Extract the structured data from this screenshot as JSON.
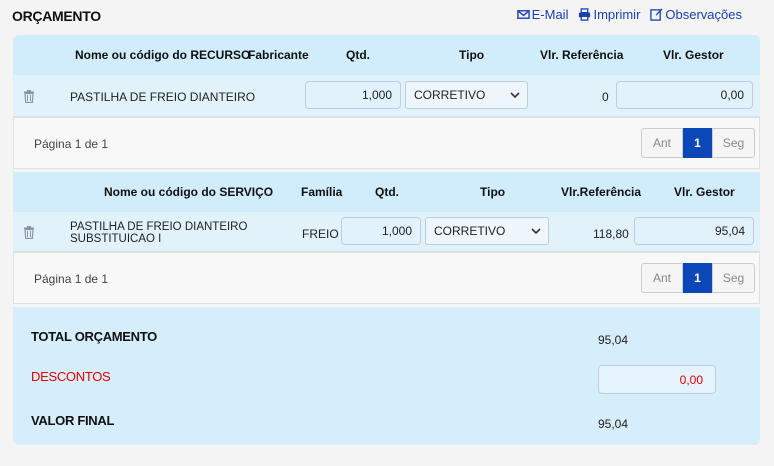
{
  "header": {
    "title": "ORÇAMENTO",
    "email_label": "E-Mail",
    "print_label": "Imprimir",
    "notes_label": "Observações"
  },
  "resources": {
    "columns": [
      "Nome ou código do RECURSO",
      "Fabricante",
      "Qtd.",
      "Tipo",
      "Vlr. Referência",
      "Vlr. Gestor"
    ],
    "rows": [
      {
        "name": "PASTILHA DE FREIO DIANTEIRO",
        "manufacturer": "",
        "qty": "1,000",
        "type": "CORRETIVO",
        "ref_value": "0",
        "manager_value": "0,00"
      }
    ],
    "pagination": {
      "info": "Página 1 de 1",
      "prev": "Ant",
      "current": "1",
      "next": "Seg"
    }
  },
  "services": {
    "columns": [
      "Nome ou código do SERVIÇO",
      "Família",
      "Qtd.",
      "Tipo",
      "Vlr.Referência",
      "Vlr. Gestor"
    ],
    "rows": [
      {
        "name": "PASTILHA DE FREIO DIANTEIRO SUBSTITUICAO I",
        "family": "FREIO",
        "qty": "1,000",
        "type": "CORRETIVO",
        "ref_value": "118,80",
        "manager_value": "95,04"
      }
    ],
    "pagination": {
      "info": "Página 1 de 1",
      "prev": "Ant",
      "current": "1",
      "next": "Seg"
    }
  },
  "totals": {
    "total_label": "TOTAL ORÇAMENTO",
    "total_value": "95,04",
    "discount_label": "DESCONTOS",
    "discount_value": "0,00",
    "final_label": "VALOR FINAL",
    "final_value": "95,04"
  },
  "colors": {
    "accent": "#0b47b6",
    "link": "#1a3fae",
    "discount": "#e00000",
    "header_bg": "#d1ecfa"
  }
}
